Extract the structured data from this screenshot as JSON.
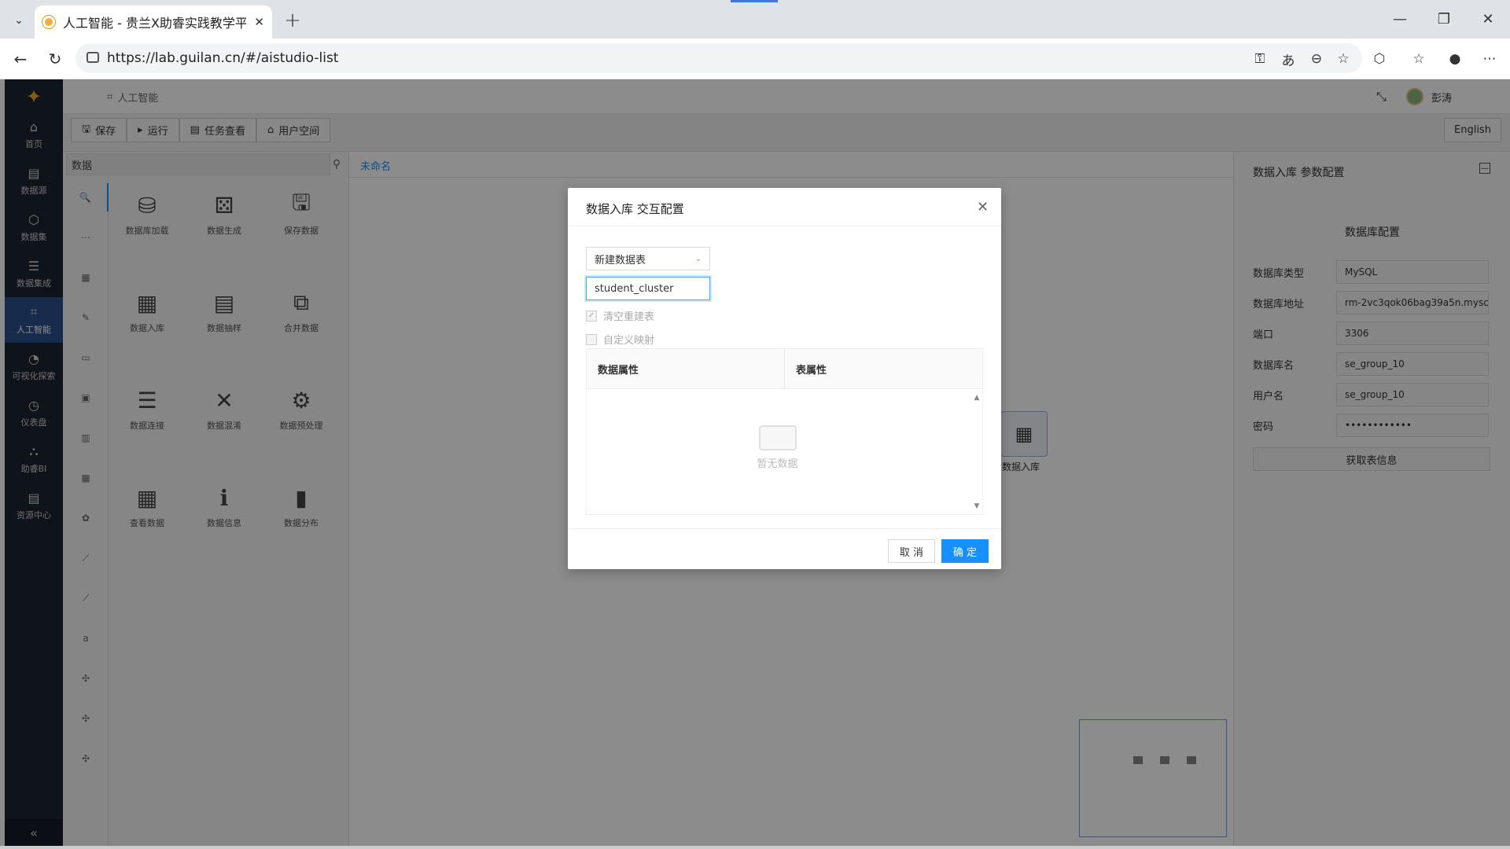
{
  "browser": {
    "tab_title": "人工智能 - 贵兰X助睿实践教学平台",
    "url": "https://lab.guilan.cn/#/aistudio-list"
  },
  "sidebar": {
    "items": [
      {
        "label": "首页",
        "icon": "home-icon"
      },
      {
        "label": "数据源",
        "icon": "datasource-icon"
      },
      {
        "label": "数据集",
        "icon": "dataset-icon"
      },
      {
        "label": "数据集成",
        "icon": "integration-icon"
      },
      {
        "label": "人工智能",
        "icon": "ai-icon",
        "active": true
      },
      {
        "label": "可视化探索",
        "icon": "chart-icon"
      },
      {
        "label": "仪表盘",
        "icon": "dashboard-icon"
      },
      {
        "label": "助睿BI",
        "icon": "bi-icon"
      },
      {
        "label": "资源中心",
        "icon": "resource-icon"
      }
    ],
    "collapse": "«"
  },
  "header": {
    "breadcrumb": "人工智能",
    "user": "彭涛"
  },
  "toolbar": {
    "save": "保存",
    "run": "运行",
    "tasks": "任务查看",
    "user_space": "用户空间",
    "lang": "English"
  },
  "components": {
    "search": "数据",
    "nodes": [
      {
        "label": "数据库加载",
        "glyph": "⛁"
      },
      {
        "label": "数据生成",
        "glyph": "⚄"
      },
      {
        "label": "保存数据",
        "glyph": "🖫"
      },
      {
        "label": "数据入库",
        "glyph": "▦"
      },
      {
        "label": "数据抽样",
        "glyph": "▤"
      },
      {
        "label": "合并数据",
        "glyph": "⧉"
      },
      {
        "label": "数据连接",
        "glyph": "☰"
      },
      {
        "label": "数据混淆",
        "glyph": "✕"
      },
      {
        "label": "数据预处理",
        "glyph": "⚙"
      },
      {
        "label": "查看数据",
        "glyph": "▦"
      },
      {
        "label": "数据信息",
        "glyph": "ℹ"
      },
      {
        "label": "数据分布",
        "glyph": "▮"
      }
    ],
    "cats": [
      "🔍",
      "⋯",
      "▦",
      "✎",
      "▭",
      "▣",
      "▥",
      "▦",
      "✿",
      "⟋",
      "⟋",
      "a",
      "✣",
      "✣",
      "✣"
    ]
  },
  "canvas": {
    "tab": "未命名",
    "node_label": "数据入库"
  },
  "right_panel": {
    "title": "数据入库 参数配置",
    "section": "数据库配置",
    "fields": [
      {
        "label": "数据库类型",
        "value": "MySQL"
      },
      {
        "label": "数据库地址",
        "value": "rm-2vc3qok06bag39a5n.mysc"
      },
      {
        "label": "端口",
        "value": "3306"
      },
      {
        "label": "数据库名",
        "value": "se_group_10"
      },
      {
        "label": "用户名",
        "value": "se_group_10"
      },
      {
        "label": "密码",
        "value": "••••••••••••"
      }
    ],
    "fetch": "获取表信息"
  },
  "modal": {
    "title": "数据入库 交互配置",
    "select": "新建数据表",
    "input": "student_cluster",
    "clear_rebuild": "清空重建表",
    "custom_map": "自定义映射",
    "col_a": "数据属性",
    "col_b": "表属性",
    "empty": "暂无数据",
    "cancel": "取 消",
    "ok": "确 定"
  }
}
